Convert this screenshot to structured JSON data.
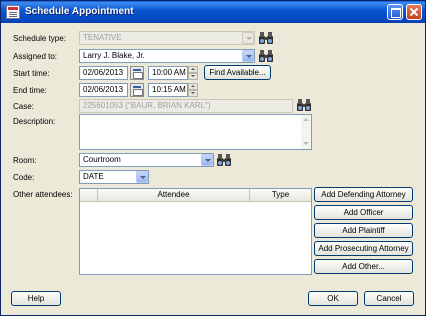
{
  "window": {
    "title": "Schedule Appointment"
  },
  "labels": {
    "schedule_type": "Schedule type:",
    "assigned_to": "Assigned to:",
    "start_time": "Start time:",
    "end_time": "End time:",
    "case": "Case:",
    "description": "Description:",
    "room": "Room:",
    "code": "Code:",
    "other_attendees": "Other attendees:"
  },
  "fields": {
    "schedule_type": "TENATIVE",
    "assigned_to": "Larry J. Blake, Jr.",
    "start_date": "02/06/2013",
    "start_time": "10:00 AM",
    "end_date": "02/06/2013",
    "end_time": "10:15 AM",
    "case": "225601053 (\"BAUR, BRIAN KARL\")",
    "description": "",
    "room": "Courtroom",
    "code": "DATE"
  },
  "buttons": {
    "find_available": "Find Available...",
    "add_defending_attorney": "Add Defending Attorney",
    "add_officer": "Add Officer",
    "add_plaintiff": "Add Plaintiff",
    "add_prosecuting_attorney": "Add Prosecuting Attorney",
    "add_other": "Add Other...",
    "help": "Help",
    "ok": "OK",
    "cancel": "Cancel"
  },
  "attendees_table": {
    "columns": [
      "",
      "Attendee",
      "Type"
    ],
    "rows": []
  },
  "icons": {
    "binoculars": "binoculars-icon",
    "calendar": "calendar-icon"
  }
}
